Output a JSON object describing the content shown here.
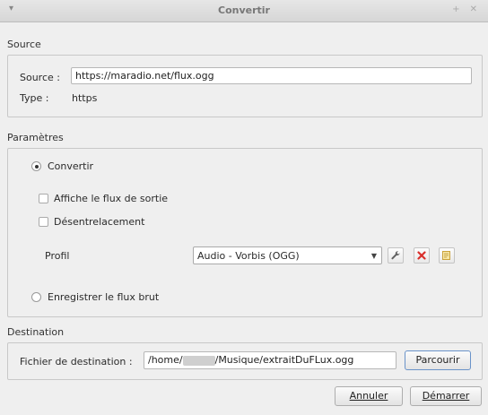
{
  "window": {
    "title": "Convertir",
    "menu_glyph": "▾",
    "controls": "+ ✕"
  },
  "source": {
    "section_label": "Source",
    "source_label": "Source :",
    "source_value": "https://maradio.net/flux.ogg",
    "type_label": "Type :",
    "type_value": "https"
  },
  "params": {
    "section_label": "Paramètres",
    "convert_label": "Convertir",
    "show_output_label": "Affiche le flux de sortie",
    "deinterlace_label": "Désentrelacement",
    "profile_label": "Profil",
    "profile_value": "Audio - Vorbis (OGG)",
    "raw_dump_label": "Enregistrer le flux brut"
  },
  "destination": {
    "section_label": "Destination",
    "file_label": "Fichier de destination :",
    "path_prefix": "/home/",
    "path_suffix": "/Musique/extraitDuFLux.ogg",
    "browse_label": "Parcourir"
  },
  "buttons": {
    "cancel_label": "Annuler",
    "start_label": "Démarrer"
  },
  "colors": {
    "delete_icon": "#d9302c",
    "wrench_icon": "#606060",
    "note_icon": "#caa23a",
    "focus": "#6a93c9"
  },
  "icons": [
    "wrench-icon",
    "delete-icon",
    "edit-icon",
    "dropdown-arrow-icon"
  ]
}
